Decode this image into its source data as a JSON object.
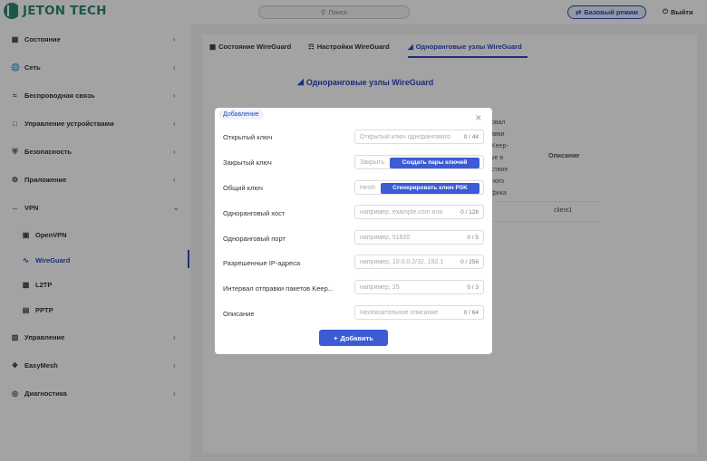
{
  "header": {
    "logo_text": "JETON TECH",
    "search_placeholder": "Поиск",
    "mode_button": "Базовый режим",
    "logout": "Выйти"
  },
  "sidebar": {
    "items": [
      {
        "label": "Состояние",
        "icon": "grid-icon"
      },
      {
        "label": "Сеть",
        "icon": "globe-icon"
      },
      {
        "label": "Беспроводная связь",
        "icon": "wifi-icon"
      },
      {
        "label": "Управление устройствами",
        "icon": "monitor-icon"
      },
      {
        "label": "Безопасность",
        "icon": "shield-icon"
      },
      {
        "label": "Приложение",
        "icon": "app-icon"
      },
      {
        "label": "VPN",
        "icon": "vpn-icon"
      },
      {
        "label": "OpenVPN",
        "icon": "openvpn-icon"
      },
      {
        "label": "WireGuard",
        "icon": "wireguard-icon"
      },
      {
        "label": "L2TP",
        "icon": "l2tp-icon"
      },
      {
        "label": "PPTP",
        "icon": "pptp-icon"
      },
      {
        "label": "Управление",
        "icon": "briefcase-icon"
      },
      {
        "label": "EasyMesh",
        "icon": "mesh-icon"
      },
      {
        "label": "Диагностика",
        "icon": "diagnostics-icon"
      }
    ]
  },
  "main": {
    "tabs": [
      {
        "label": "Состояние WireGuard"
      },
      {
        "label": "Настройки WireGuard"
      },
      {
        "label": "Одноранговые узлы WireGuard"
      }
    ],
    "section_title": "Одноранговые узлы WireGuard",
    "table": {
      "header_fragment": [
        "рвал",
        "авки",
        "Keep-",
        "ve в",
        "ствие",
        "ного",
        "фика"
      ],
      "description_header": "Описание",
      "row_description": "client1"
    }
  },
  "modal": {
    "tab_label": "Добавление",
    "fields": [
      {
        "label": "Открытый ключ",
        "placeholder": "Открытый ключ однорангового",
        "count": "0 / 44"
      },
      {
        "label": "Закрытый ключ",
        "placeholder": "Закрыть",
        "button": "Создать пары ключей"
      },
      {
        "label": "Общий ключ",
        "placeholder": "Необ",
        "button": "Сгенерировать ключ PSK"
      },
      {
        "label": "Одноранговый хост",
        "placeholder": "например, example.com или",
        "count": "0 / 128"
      },
      {
        "label": "Одноранговый порт",
        "placeholder": "например, 51820",
        "count": "0 / 5"
      },
      {
        "label": "Разрешенные IP-адреса",
        "placeholder": "например, 10.0.0.2/32, 192.1",
        "count": "0 / 256"
      },
      {
        "label": "Интервал отправки пакетов Keep...",
        "placeholder": "например, 25",
        "count": "0 / 3"
      },
      {
        "label": "Описание",
        "placeholder": "Необязательное описание",
        "count": "0 / 64"
      }
    ],
    "add_button": "Добавить"
  },
  "colors": {
    "brand": "#2a8a74",
    "accent": "#2b4ab8",
    "button": "#3c5bd5"
  }
}
